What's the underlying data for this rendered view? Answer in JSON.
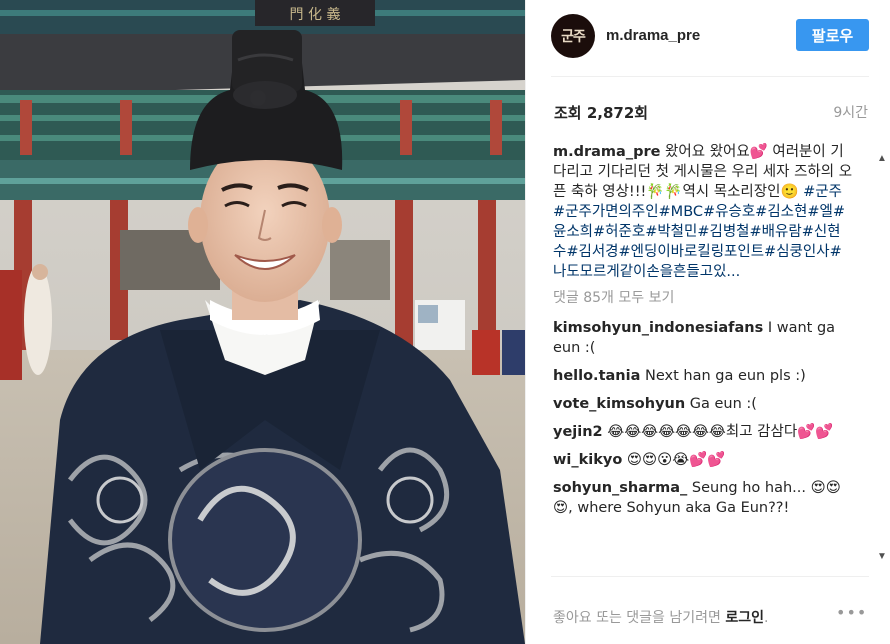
{
  "post": {
    "username": "m.drama_pre",
    "avatar_text": "군주",
    "follow_label": "팔로우",
    "views": "조회 2,872회",
    "time_ago": "9시간",
    "caption_user": "m.drama_pre",
    "caption_text": " 왔어요 왔어요💕 여러분이 기다리고 기다리던 첫 게시물은 우리 세자 즈하의 오픈 축하 영상!!!🎋🎋역시 목소리장인🙂 ",
    "caption_tags": "#군주#군주가면의주인#MBC#유승호#김소현#엘#윤소희#허준호#박철민#김병철#배유람#신현수#김서경#엔딩이바로킬링포인트#심쿵인사#나도모르게같이손을흔들고있...",
    "view_all_comments": "댓글 85개 모두 보기",
    "comments": [
      {
        "user": "kimsohyun_indonesiafans",
        "text": "I want ga eun :("
      },
      {
        "user": "hello.tania",
        "text": "Next han ga eun pls :)"
      },
      {
        "user": "vote_kimsohyun",
        "text": "Ga eun :("
      },
      {
        "user": "yejin2",
        "text": "😂😂😂😂😂😂😂최고 감삼다💕💕"
      },
      {
        "user": "wi_kikyo",
        "text": "😍😍😮😭💕💕"
      },
      {
        "user": "sohyun_sharma_",
        "text": "Seung ho hah... 😍😍😍, where Sohyun aka Ga Eun??!"
      }
    ],
    "footer_text": "좋아요 또는 댓글을 남기려면 ",
    "login_label": "로그인",
    "footer_period": ".",
    "more_label": "•••"
  },
  "media": {
    "sign_text": "門 化 義"
  },
  "icons": {
    "scroll_up": "scroll-up-arrow-icon",
    "scroll_down": "scroll-down-arrow-icon",
    "more": "more-options-icon"
  },
  "colors": {
    "follow_button": "#3897f0",
    "hashtag": "#003569",
    "muted": "#999999"
  }
}
